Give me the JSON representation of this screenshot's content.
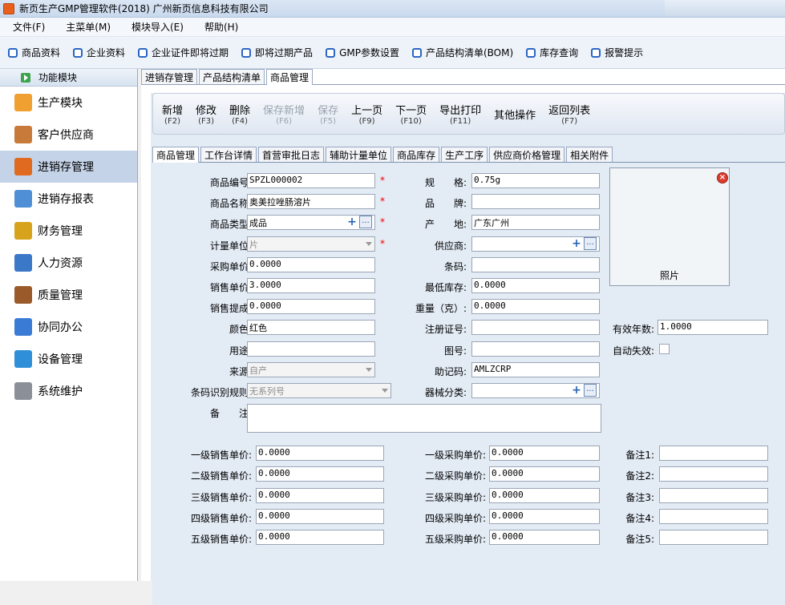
{
  "window": {
    "title": "新页生产GMP管理软件(2018) 广州新页信息科技有限公司"
  },
  "menu": [
    "文件(F)",
    "主菜单(M)",
    "模块导入(E)",
    "帮助(H)"
  ],
  "quickbar": [
    "商品资料",
    "企业资料",
    "企业证件即将过期",
    "即将过期产品",
    "GMP参数设置",
    "产品结构清单(BOM)",
    "库存查询",
    "报警提示"
  ],
  "sidebar": {
    "header": "功能模块",
    "items": [
      {
        "label": "生产模块",
        "icon": "folder-icon",
        "color": "#f0a030"
      },
      {
        "label": "客户供应商",
        "icon": "users-icon",
        "color": "#c87a3a"
      },
      {
        "label": "进销存管理",
        "icon": "bar-chart-icon",
        "color": "#e06a20"
      },
      {
        "label": "进销存报表",
        "icon": "report-icon",
        "color": "#4f8fd6"
      },
      {
        "label": "财务管理",
        "icon": "coins-icon",
        "color": "#d8a31c"
      },
      {
        "label": "人力资源",
        "icon": "person-icon",
        "color": "#3c78c8"
      },
      {
        "label": "质量管理",
        "icon": "book-icon",
        "color": "#9a5a2a"
      },
      {
        "label": "协同办公",
        "icon": "calendar-icon",
        "color": "#3a7bd5"
      },
      {
        "label": "设备管理",
        "icon": "device-icon",
        "color": "#2f8fd8"
      },
      {
        "label": "系统维护",
        "icon": "lock-icon",
        "color": "#8a8f98"
      }
    ],
    "active": 2
  },
  "doc_tabs": [
    "进销存管理",
    "产品结构清单",
    "商品管理"
  ],
  "actions": [
    {
      "label": "新增",
      "key": "(F2)",
      "enabled": true
    },
    {
      "label": "修改",
      "key": "(F3)",
      "enabled": true
    },
    {
      "label": "删除",
      "key": "(F4)",
      "enabled": true
    },
    {
      "label": "保存新增",
      "key": "(F6)",
      "enabled": false
    },
    {
      "label": "保存",
      "key": "(F5)",
      "enabled": false
    },
    {
      "label": "上一页",
      "key": "(F9)",
      "enabled": true
    },
    {
      "label": "下一页",
      "key": "(F10)",
      "enabled": true
    },
    {
      "label": "导出打印",
      "key": "(F11)",
      "enabled": true
    },
    {
      "label": "其他操作",
      "key": "",
      "enabled": true
    },
    {
      "label": "返回列表",
      "key": "(F7)",
      "enabled": true
    }
  ],
  "sub_tabs": [
    "商品管理",
    "工作台详情",
    "首营审批日志",
    "辅助计量单位",
    "商品库存",
    "生产工序",
    "供应商价格管理",
    "相关附件"
  ],
  "form": {
    "col1": [
      {
        "label": "商品编号:",
        "value": "SPZL000002"
      },
      {
        "label": "商品名称:",
        "value": "奥美拉唑肠溶片"
      },
      {
        "label": "商品类型:",
        "value": "成品"
      },
      {
        "label": "计量单位:",
        "value": "片"
      },
      {
        "label": "采购单价:",
        "value": "0.0000"
      },
      {
        "label": "销售单价:",
        "value": "3.0000"
      },
      {
        "label": "销售提成:",
        "value": "0.0000"
      },
      {
        "label": "颜色:",
        "value": "红色"
      },
      {
        "label": "用途:",
        "value": ""
      },
      {
        "label": "来源:",
        "value": "自产"
      },
      {
        "label": "条码识别规则:",
        "value": "无系列号"
      }
    ],
    "col2": [
      {
        "label": "规　　格:",
        "value": "0.75g"
      },
      {
        "label": "品　　牌:",
        "value": ""
      },
      {
        "label": "产　　地:",
        "value": "广东广州"
      },
      {
        "label": "供应商:",
        "value": ""
      },
      {
        "label": "条码:",
        "value": ""
      },
      {
        "label": "最低库存:",
        "value": "0.0000"
      },
      {
        "label": "重量（克）:",
        "value": "0.0000"
      },
      {
        "label": "注册证号:",
        "value": ""
      },
      {
        "label": "图号:",
        "value": ""
      },
      {
        "label": "助记码:",
        "value": "AMLZCRP"
      },
      {
        "label": "器械分类:",
        "value": ""
      }
    ],
    "photo_label": "照片",
    "validity": {
      "label": "有效年数:",
      "value": "1.0000"
    },
    "auto_expire": {
      "label": "自动失效:"
    },
    "remark": {
      "label": "备　　注:",
      "value": ""
    },
    "sale_levels": [
      {
        "label": "一级销售单价:",
        "value": "0.0000"
      },
      {
        "label": "二级销售单价:",
        "value": "0.0000"
      },
      {
        "label": "三级销售单价:",
        "value": "0.0000"
      },
      {
        "label": "四级销售单价:",
        "value": "0.0000"
      },
      {
        "label": "五级销售单价:",
        "value": "0.0000"
      }
    ],
    "purchase_levels": [
      {
        "label": "一级采购单价:",
        "value": "0.0000"
      },
      {
        "label": "二级采购单价:",
        "value": "0.0000"
      },
      {
        "label": "三级采购单价:",
        "value": "0.0000"
      },
      {
        "label": "四级采购单价:",
        "value": "0.0000"
      },
      {
        "label": "五级采购单价:",
        "value": "0.0000"
      }
    ],
    "notes": [
      {
        "label": "备注1:",
        "value": ""
      },
      {
        "label": "备注2:",
        "value": ""
      },
      {
        "label": "备注3:",
        "value": ""
      },
      {
        "label": "备注4:",
        "value": ""
      },
      {
        "label": "备注5:",
        "value": ""
      }
    ],
    "required_mark": "*"
  }
}
